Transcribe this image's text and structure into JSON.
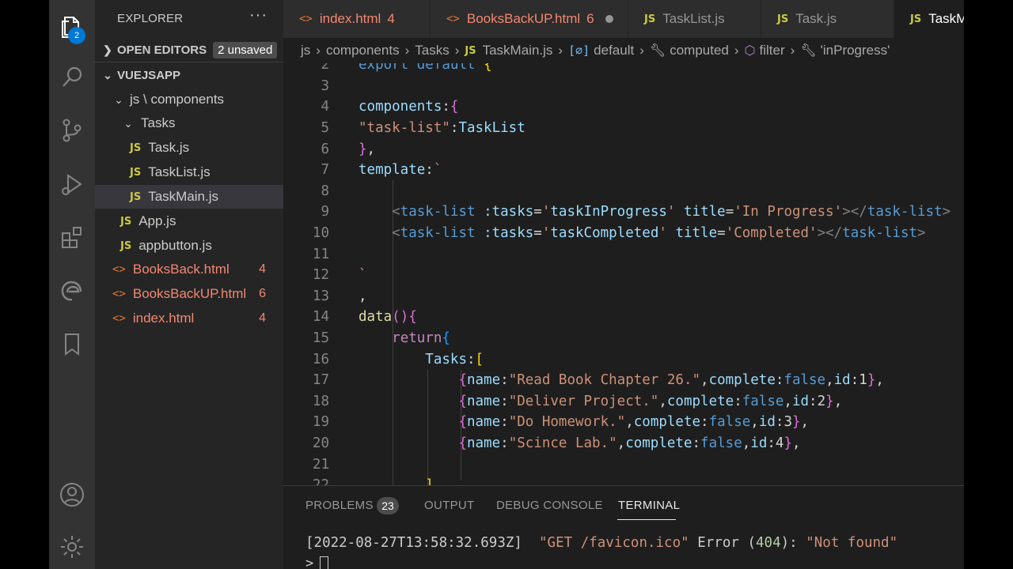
{
  "explorer": {
    "title": "EXPLORER",
    "more": "···",
    "open_editors": {
      "label": "OPEN EDITORS",
      "unsaved": "2 unsaved"
    },
    "root": "VUEJSAPP",
    "folder_path": "js \\ components",
    "subfolder": "Tasks",
    "tasks_files": [
      "Task.js",
      "TaskList.js",
      "TaskMain.js"
    ],
    "js_files": [
      "App.js",
      "appbutton.js"
    ],
    "html_files": [
      {
        "name": "BooksBack.html",
        "errors": "4"
      },
      {
        "name": "BooksBackUP.html",
        "errors": "6"
      },
      {
        "name": "index.html",
        "errors": "4"
      }
    ],
    "js_badge": "JS",
    "html_badge": "<>"
  },
  "activity": {
    "source_control_badge": "2"
  },
  "tabs": [
    {
      "name": "index.html",
      "icon": "<>",
      "errors": "4",
      "kind": "html"
    },
    {
      "name": "BooksBackUP.html",
      "icon": "<>",
      "errors": "6",
      "kind": "html",
      "modified": true
    },
    {
      "name": "TaskList.js",
      "icon": "JS",
      "kind": "js"
    },
    {
      "name": "Task.js",
      "icon": "JS",
      "kind": "js"
    },
    {
      "name": "TaskMain.js",
      "icon": "JS",
      "kind": "js",
      "active": true
    }
  ],
  "breadcrumb": {
    "items": [
      "js",
      "components",
      "Tasks",
      "TaskMain.js",
      "default",
      "computed",
      "filter",
      "'inProgress'"
    ],
    "js_icon": "JS",
    "sym_icon": "[⌀]"
  },
  "editor": {
    "lines": [
      {
        "n": "2",
        "tokens": [
          [
            "t-kw",
            "export"
          ],
          [
            "t-plain",
            " "
          ],
          [
            "t-kw",
            "default"
          ],
          [
            "t-plain",
            " "
          ],
          [
            "t-brk1",
            "{"
          ]
        ]
      },
      {
        "n": "3",
        "tokens": []
      },
      {
        "n": "4",
        "tokens": [
          [
            "t-var",
            "components"
          ],
          [
            "t-plain",
            ":"
          ],
          [
            "t-brk2",
            "{"
          ]
        ]
      },
      {
        "n": "5",
        "tokens": [
          [
            "t-str",
            "\"task-list\""
          ],
          [
            "t-plain",
            ":"
          ],
          [
            "t-var",
            "TaskList"
          ]
        ]
      },
      {
        "n": "6",
        "tokens": [
          [
            "t-brk2",
            "}"
          ],
          [
            "t-plain",
            ","
          ]
        ]
      },
      {
        "n": "7",
        "tokens": [
          [
            "t-var",
            "template"
          ],
          [
            "t-plain",
            ":"
          ],
          [
            "t-str",
            "`"
          ]
        ]
      },
      {
        "n": "8",
        "tokens": []
      },
      {
        "n": "9",
        "tokens": [
          [
            "t-plain",
            "    "
          ],
          [
            "t-punc",
            "<"
          ],
          [
            "t-tag",
            "task-list"
          ],
          [
            "t-plain",
            " "
          ],
          [
            "t-var",
            ":tasks"
          ],
          [
            "t-plain",
            "="
          ],
          [
            "t-str",
            "'"
          ],
          [
            "t-var",
            "taskInProgress"
          ],
          [
            "t-str",
            "'"
          ],
          [
            "t-plain",
            " "
          ],
          [
            "t-var",
            "title"
          ],
          [
            "t-plain",
            "="
          ],
          [
            "t-str",
            "'In Progress'"
          ],
          [
            "t-punc",
            "></"
          ],
          [
            "t-tag",
            "task-list"
          ],
          [
            "t-punc",
            ">"
          ]
        ]
      },
      {
        "n": "10",
        "tokens": [
          [
            "t-plain",
            "    "
          ],
          [
            "t-punc",
            "<"
          ],
          [
            "t-tag",
            "task-list"
          ],
          [
            "t-plain",
            " "
          ],
          [
            "t-var",
            ":tasks"
          ],
          [
            "t-plain",
            "="
          ],
          [
            "t-str",
            "'"
          ],
          [
            "t-var",
            "taskCompleted"
          ],
          [
            "t-str",
            "'"
          ],
          [
            "t-plain",
            " "
          ],
          [
            "t-var",
            "title"
          ],
          [
            "t-plain",
            "="
          ],
          [
            "t-str",
            "'Completed'"
          ],
          [
            "t-punc",
            "></"
          ],
          [
            "t-tag",
            "task-list"
          ],
          [
            "t-punc",
            ">"
          ]
        ]
      },
      {
        "n": "11",
        "tokens": []
      },
      {
        "n": "12",
        "tokens": [
          [
            "t-str",
            "`"
          ]
        ]
      },
      {
        "n": "13",
        "tokens": [
          [
            "t-plain",
            ","
          ]
        ]
      },
      {
        "n": "14",
        "tokens": [
          [
            "t-fn",
            "data"
          ],
          [
            "t-brk2",
            "()"
          ],
          [
            "t-brk2",
            "{"
          ]
        ]
      },
      {
        "n": "15",
        "tokens": [
          [
            "t-plain",
            "    "
          ],
          [
            "t-ctrl",
            "return"
          ],
          [
            "t-brk3",
            "{"
          ]
        ]
      },
      {
        "n": "16",
        "tokens": [
          [
            "t-plain",
            "        "
          ],
          [
            "t-var",
            "Tasks"
          ],
          [
            "t-plain",
            ":"
          ],
          [
            "t-brk1",
            "["
          ]
        ]
      },
      {
        "n": "17",
        "tokens": [
          [
            "t-plain",
            "            "
          ],
          [
            "t-brk2",
            "{"
          ],
          [
            "t-var",
            "name"
          ],
          [
            "t-plain",
            ":"
          ],
          [
            "t-str",
            "\"Read Book Chapter 26.\""
          ],
          [
            "t-plain",
            ","
          ],
          [
            "t-var",
            "complete"
          ],
          [
            "t-plain",
            ":"
          ],
          [
            "t-kw",
            "false"
          ],
          [
            "t-plain",
            ","
          ],
          [
            "t-var",
            "id"
          ],
          [
            "t-plain",
            ":"
          ],
          [
            "t-plain",
            "1"
          ],
          [
            "t-brk2",
            "}"
          ],
          [
            "t-plain",
            ","
          ]
        ]
      },
      {
        "n": "18",
        "tokens": [
          [
            "t-plain",
            "            "
          ],
          [
            "t-brk2",
            "{"
          ],
          [
            "t-var",
            "name"
          ],
          [
            "t-plain",
            ":"
          ],
          [
            "t-str",
            "\"Deliver Project.\""
          ],
          [
            "t-plain",
            ","
          ],
          [
            "t-var",
            "complete"
          ],
          [
            "t-plain",
            ":"
          ],
          [
            "t-kw",
            "false"
          ],
          [
            "t-plain",
            ","
          ],
          [
            "t-var",
            "id"
          ],
          [
            "t-plain",
            ":"
          ],
          [
            "t-plain",
            "2"
          ],
          [
            "t-brk2",
            "}"
          ],
          [
            "t-plain",
            ","
          ]
        ]
      },
      {
        "n": "19",
        "tokens": [
          [
            "t-plain",
            "            "
          ],
          [
            "t-brk2",
            "{"
          ],
          [
            "t-var",
            "name"
          ],
          [
            "t-plain",
            ":"
          ],
          [
            "t-str",
            "\"Do Homework.\""
          ],
          [
            "t-plain",
            ","
          ],
          [
            "t-var",
            "complete"
          ],
          [
            "t-plain",
            ":"
          ],
          [
            "t-kw",
            "false"
          ],
          [
            "t-plain",
            ","
          ],
          [
            "t-var",
            "id"
          ],
          [
            "t-plain",
            ":"
          ],
          [
            "t-plain",
            "3"
          ],
          [
            "t-brk2",
            "}"
          ],
          [
            "t-plain",
            ","
          ]
        ]
      },
      {
        "n": "20",
        "tokens": [
          [
            "t-plain",
            "            "
          ],
          [
            "t-brk2",
            "{"
          ],
          [
            "t-var",
            "name"
          ],
          [
            "t-plain",
            ":"
          ],
          [
            "t-str",
            "\"Scince Lab.\""
          ],
          [
            "t-plain",
            ","
          ],
          [
            "t-var",
            "complete"
          ],
          [
            "t-plain",
            ":"
          ],
          [
            "t-kw",
            "false"
          ],
          [
            "t-plain",
            ","
          ],
          [
            "t-var",
            "id"
          ],
          [
            "t-plain",
            ":"
          ],
          [
            "t-plain",
            "4"
          ],
          [
            "t-brk2",
            "}"
          ],
          [
            "t-plain",
            ","
          ]
        ]
      },
      {
        "n": "21",
        "tokens": []
      },
      {
        "n": "22",
        "tokens": [
          [
            "t-plain",
            "        "
          ],
          [
            "t-brk1",
            "]"
          ]
        ]
      }
    ]
  },
  "panel": {
    "tabs": [
      "PROBLEMS",
      "OUTPUT",
      "DEBUG CONSOLE",
      "TERMINAL"
    ],
    "problems_count": "23",
    "terminal": {
      "timestamp": "[2022-08-27T13:58:32.693Z]",
      "request": "\"GET /favicon.ico\"",
      "error_word": "Error",
      "code_open": "(",
      "code": "404",
      "code_close": "):",
      "message": "\"Not found\"",
      "prompt": ">"
    }
  },
  "colors": {
    "activity_bg": "#333333",
    "sidebar_bg": "#252526",
    "editor_bg": "#1e1e1e",
    "error": "#f48771",
    "badge": "#0078d4"
  }
}
